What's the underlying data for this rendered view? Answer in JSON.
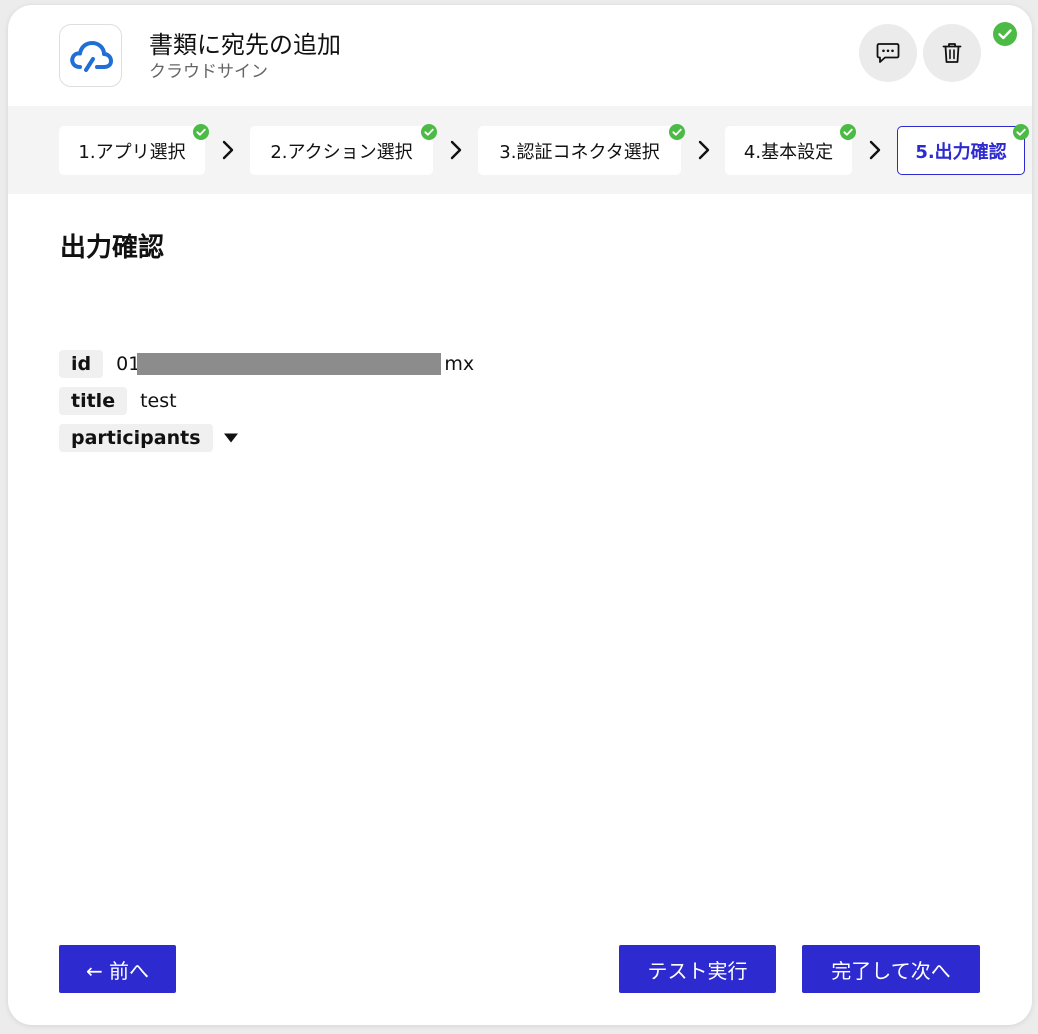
{
  "header": {
    "action_title": "書類に宛先の追加",
    "app_name": "クラウドサイン",
    "status_icon": "check-circle-icon",
    "status_color": "#4cbb45"
  },
  "steps": [
    {
      "label": "1.アプリ選択",
      "done": true
    },
    {
      "label": "2.アクション選択",
      "done": true
    },
    {
      "label": "3.認証コネクタ選択",
      "done": true
    },
    {
      "label": "4.基本設定",
      "done": true
    },
    {
      "label": "5.出力確認",
      "done": true,
      "active": true
    }
  ],
  "section": {
    "title": "出力確認"
  },
  "output": {
    "fields": [
      {
        "key": "id",
        "value_prefix": "01",
        "value_suffix": "mx",
        "redacted": true
      },
      {
        "key": "title",
        "value": "test"
      },
      {
        "key": "participants",
        "collapsed": true
      }
    ]
  },
  "footer": {
    "prev_label": "← 前へ",
    "test_label": "テスト実行",
    "done_label": "完了して次へ"
  },
  "colors": {
    "primary": "#2d2ad0",
    "check": "#4cbb45",
    "logo": "#1f6fd6"
  }
}
